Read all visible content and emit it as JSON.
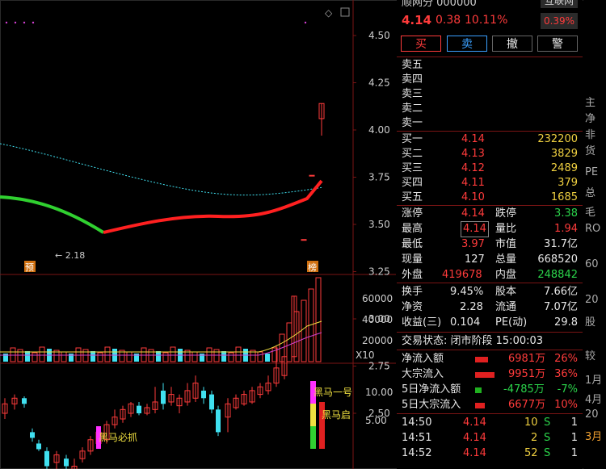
{
  "header": {
    "title_partial": "顺网分 000000",
    "price": "4.14",
    "change": "0.38",
    "pct": "10.11%",
    "tag": "互联网",
    "tag_pct": "0.39%"
  },
  "buttons": [
    "买",
    "卖",
    "撤",
    "警"
  ],
  "sell_rows": [
    "卖五",
    "卖四",
    "卖三",
    "卖二",
    "卖一"
  ],
  "buy_rows": [
    {
      "label": "买一",
      "price": "4.14",
      "vol": "232200"
    },
    {
      "label": "买二",
      "price": "4.13",
      "vol": "3829"
    },
    {
      "label": "买三",
      "price": "4.12",
      "vol": "2489"
    },
    {
      "label": "买四",
      "price": "4.11",
      "vol": "379"
    },
    {
      "label": "买五",
      "price": "4.10",
      "vol": "1685"
    }
  ],
  "stats": [
    {
      "l1": "涨停",
      "v1": "4.14",
      "l2": "跌停",
      "v2": "3.38"
    },
    {
      "l1": "最高",
      "v1": "4.14",
      "l2": "量比",
      "v2": "1.94"
    },
    {
      "l1": "最低",
      "v1": "3.97",
      "l2": "市值",
      "v2": "31.7亿"
    },
    {
      "l1": "现量",
      "v1": "127",
      "l2": "总量",
      "v2": "668520"
    },
    {
      "l1": "外盘",
      "v1": "419678",
      "l2": "内盘",
      "v2": "248842"
    }
  ],
  "fund": [
    {
      "l1": "换手",
      "v1": "9.45%",
      "l2": "股本",
      "v2": "7.66亿"
    },
    {
      "l1": "净资",
      "v1": "2.28",
      "l2": "流通",
      "v2": "7.07亿"
    },
    {
      "l1": "收益(三)",
      "v1": "0.104",
      "l2": "PE(动)",
      "v2": "29.8"
    }
  ],
  "trade_status": "交易状态: 闭市阶段 15:00:03",
  "flows": [
    {
      "label": "净流入额",
      "value": "6981万",
      "pct": "26%",
      "color": "red"
    },
    {
      "label": "大宗流入",
      "value": "9951万",
      "pct": "36%",
      "color": "red"
    },
    {
      "label": "5日净流入额",
      "value": "-4785万",
      "pct": "-7%",
      "color": "green"
    },
    {
      "label": "5日大宗流入",
      "value": "6677万",
      "pct": "10%",
      "color": "red"
    }
  ],
  "ticks": [
    {
      "time": "14:50",
      "price": "4.14",
      "vol": "10",
      "side": "S",
      "n": "1"
    },
    {
      "time": "14:51",
      "price": "4.14",
      "vol": "2",
      "side": "S",
      "n": "1"
    },
    {
      "time": "14:52",
      "price": "4.14",
      "vol": "52",
      "side": "S",
      "n": "1"
    }
  ],
  "chart": {
    "price_axis": [
      "4.50",
      "4.25",
      "4.00",
      "3.75",
      "3.50",
      "3.25",
      "3.00",
      "2.75",
      "2.50"
    ],
    "vol_axis": [
      "60000",
      "40000",
      "20000"
    ],
    "ind_axis": [
      "10.00",
      "5.00"
    ],
    "low_marker": "2.18",
    "vol_mult": "X10",
    "badge_pre": "预",
    "badge_bang": "榜",
    "label_bm1": "黑马必抓",
    "label_bm2": "黑马一号",
    "label_bm3": "黑马启"
  },
  "edge_text": [
    "主",
    "净",
    "非",
    "货",
    "PE",
    "总",
    "毛",
    "RO",
    "60",
    "20",
    "股",
    "较",
    "1月",
    "4月",
    "20",
    "3月"
  ]
}
